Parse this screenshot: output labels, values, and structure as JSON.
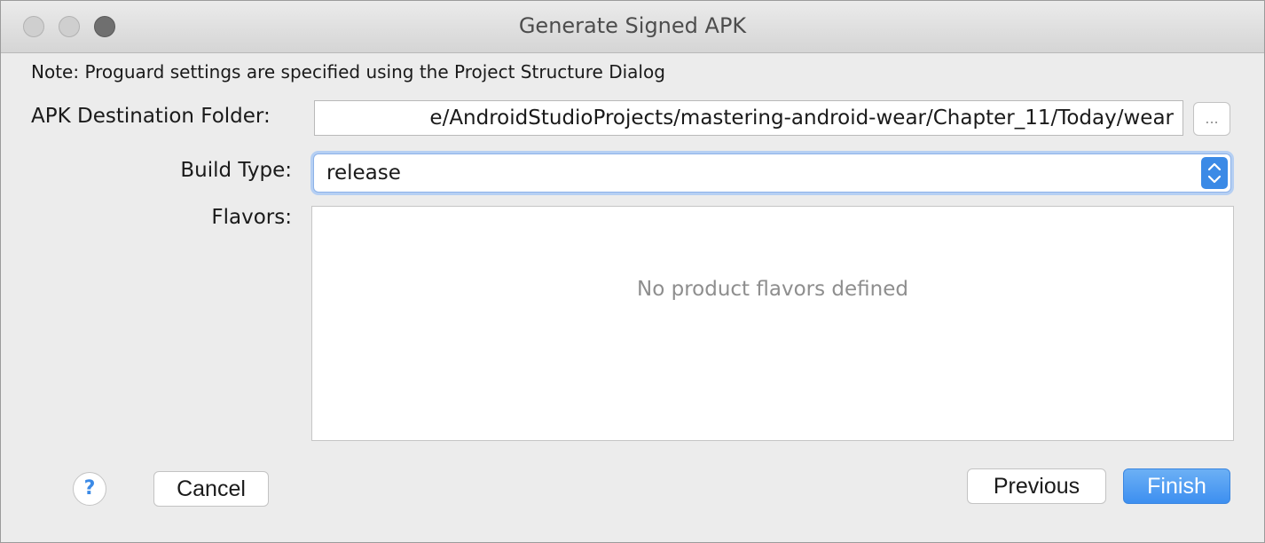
{
  "window": {
    "title": "Generate Signed APK"
  },
  "note": "Note: Proguard settings are specified using the Project Structure Dialog",
  "form": {
    "destination_label": "APK Destination Folder:",
    "destination_value": "e/AndroidStudioProjects/mastering-android-wear/Chapter_11/Today/wear",
    "browse_label": "...",
    "build_type_label": "Build Type:",
    "build_type_value": "release",
    "flavors_label": "Flavors:",
    "flavors_empty_text": "No product flavors defined"
  },
  "buttons": {
    "help": "?",
    "cancel": "Cancel",
    "previous": "Previous",
    "finish": "Finish"
  },
  "colors": {
    "accent": "#3b8ae6",
    "window_bg": "#ececec"
  }
}
